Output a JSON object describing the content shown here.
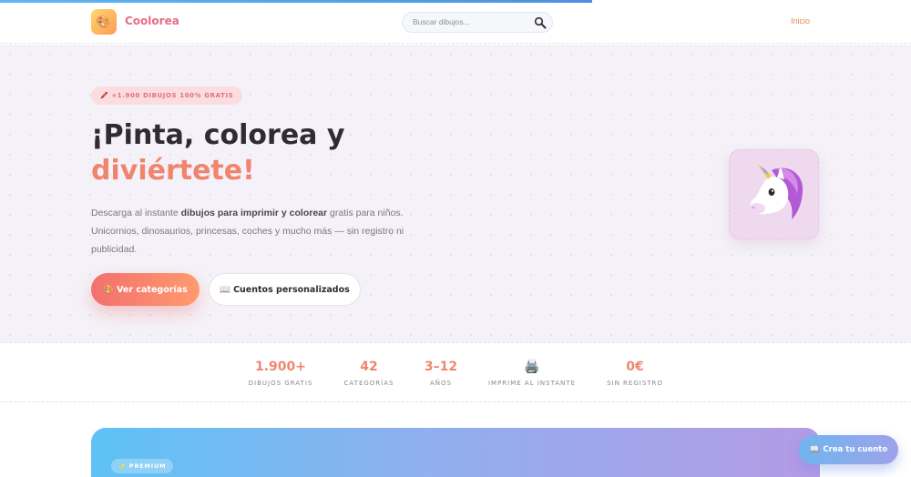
{
  "header": {
    "brand": "Coolorea",
    "logo_icon": "🎨",
    "search": {
      "placeholder": "Buscar dibujos..."
    },
    "nav": {
      "home": "Inicio"
    }
  },
  "hero": {
    "badge_icon": "🖍️",
    "badge": "+1.900 DIBUJOS 100% GRATIS",
    "title_line1": "¡Pinta, colorea y",
    "title_line2": "diviértete!",
    "description": {
      "part1": "Descarga al instante ",
      "bold1": "dibujos para imprimir y colorear",
      "part2": " gratis para niños. Unicornios, dinosaurios, princesas, coches y mucho más — sin registro ni publicidad."
    },
    "primary_button": {
      "icon": "🎨",
      "label": "Ver categorías"
    },
    "secondary_button": {
      "icon": "📖",
      "label": "Cuentos personalizados"
    },
    "illustration_icon": "unicorn-icon"
  },
  "stats": [
    {
      "value": "1.900+",
      "label": "DIBUJOS GRATIS"
    },
    {
      "value": "42",
      "label": "CATEGORÍAS"
    },
    {
      "value": "3–12",
      "label": "AÑOS"
    },
    {
      "value": "🖨️",
      "label": "IMPRIME AL INSTANTE"
    },
    {
      "value": "0€",
      "label": "SIN REGISTRO"
    }
  ],
  "premium": {
    "icon": "✨",
    "badge": "PREMIUM"
  },
  "fab": {
    "icon": "📖",
    "label": "Crea tu cuento"
  },
  "colors": {
    "accent": "#f1846e",
    "brand": "#e96b86",
    "primary_gradient_start": "#f2706e",
    "premium_gradient_start": "#5ec2f5",
    "premium_gradient_end": "#b49ae5"
  }
}
